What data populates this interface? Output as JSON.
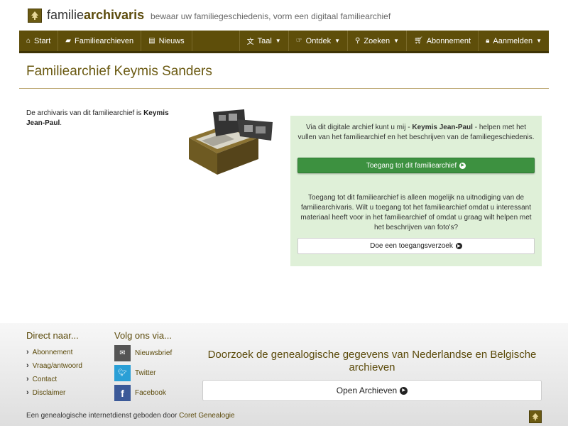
{
  "header": {
    "brand_plain": "familie",
    "brand_bold": "archivaris",
    "tagline": "bewaar uw familiegeschiedenis, vorm een digitaal familiearchief"
  },
  "nav": {
    "start": "Start",
    "archives": "Familiearchieven",
    "news": "Nieuws",
    "language": "Taal",
    "discover": "Ontdek",
    "search": "Zoeken",
    "subscription": "Abonnement",
    "login": "Aanmelden"
  },
  "page": {
    "title": "Familiearchief Keymis Sanders",
    "intro_prefix": "De archivaris van dit familiearchief is ",
    "archivist": "Keymis Jean-Paul",
    "intro_suffix": "."
  },
  "panel": {
    "help_prefix": "Via dit digitale archief kunt u mij - ",
    "help_name": "Keymis Jean-Paul",
    "help_suffix": " - helpen met het vullen van het familiearchief en het beschrijven van de familiegeschiedenis.",
    "access_button": "Toegang tot dit familiearchief",
    "invite_text": "Toegang tot dit familiearchief is alleen mogelijk na uitnodiging van de familiearchivaris. Wilt u toegang tot het familiearchief omdat u interessant materiaal heeft voor in het familiearchief of omdat u graag wilt helpen met het beschrijven van foto's?",
    "request_button": "Doe een toegangsverzoek"
  },
  "footer": {
    "direct_head": "Direct naar...",
    "direct_links": [
      "Abonnement",
      "Vraag/antwoord",
      "Contact",
      "Disclaimer"
    ],
    "follow_head": "Volg ons via...",
    "social": [
      "Nieuwsbrief",
      "Twitter",
      "Facebook"
    ],
    "search_text": "Doorzoek de genealogische gegevens van Nederlandse en Belgische archieven",
    "open_button": "Open Archieven",
    "credit_prefix": "Een genealogische internetdienst geboden door ",
    "credit_link": "Coret Genealogie"
  },
  "colors": {
    "brand": "#5e4e0a",
    "panel_bg": "#dff0d8",
    "button_green": "#3d9140"
  }
}
